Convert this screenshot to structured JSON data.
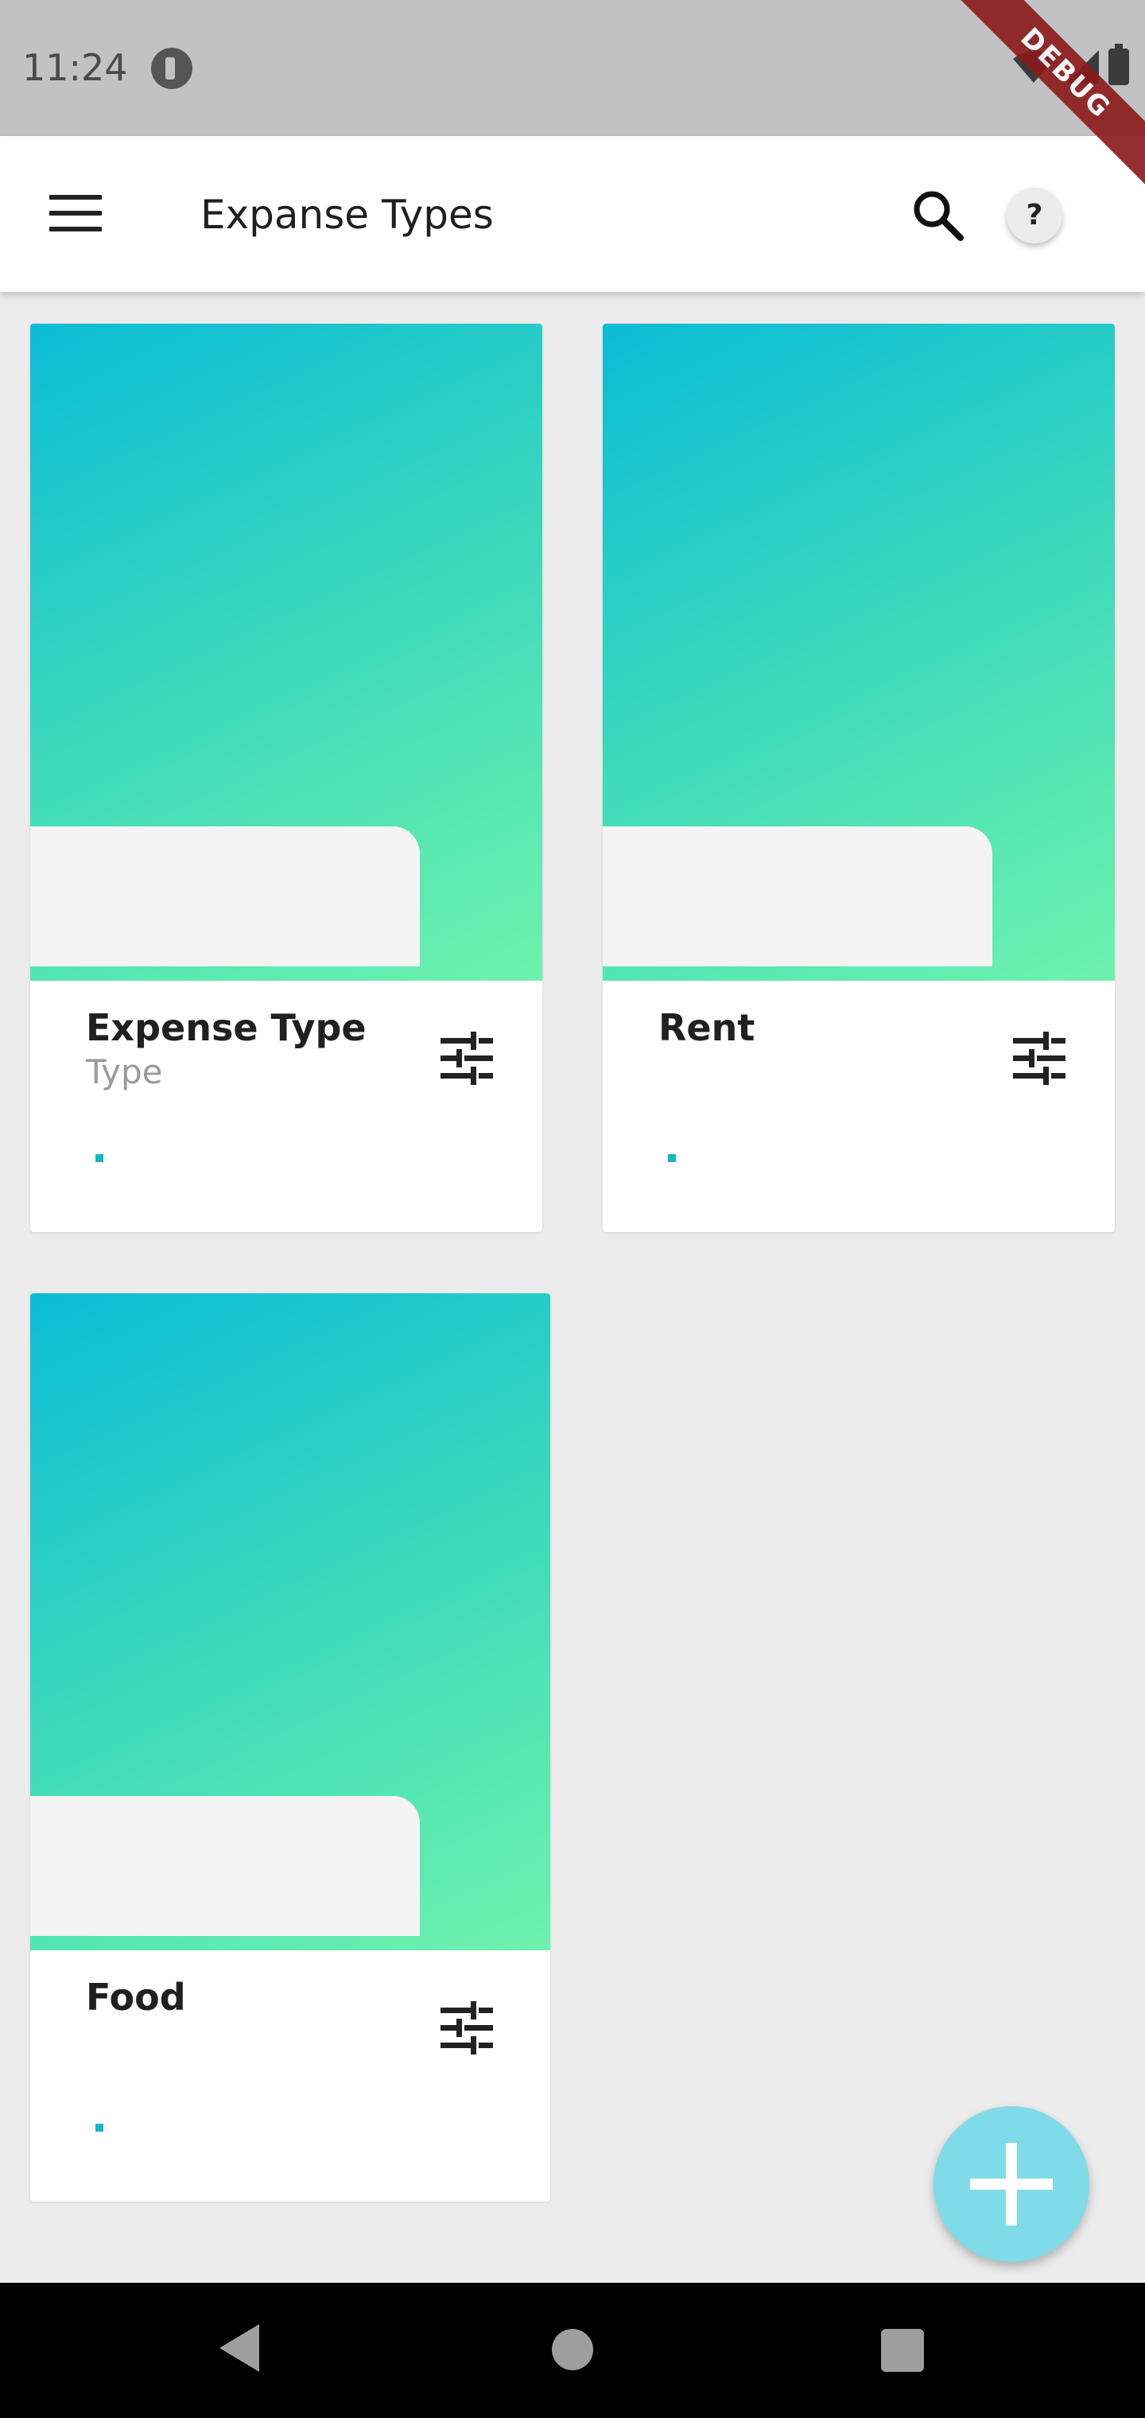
{
  "status_bar": {
    "time": "11:24",
    "icons": [
      "app-notification-icon",
      "wifi-icon",
      "signal-icon",
      "battery-icon"
    ]
  },
  "debug_banner": "DEBUG",
  "app_bar": {
    "title": "Expanse Types",
    "menu_icon": "menu-icon",
    "search_icon": "search-icon",
    "help_label": "?"
  },
  "cards": [
    {
      "title": "Expense Type",
      "subtitle": "Type",
      "action_icon": "tune-icon"
    },
    {
      "title": "Rent",
      "subtitle": "",
      "action_icon": "tune-icon"
    },
    {
      "title": "Food",
      "subtitle": "",
      "action_icon": "tune-icon"
    }
  ],
  "fab": {
    "icon": "plus-icon"
  },
  "nav_bar": {
    "icons": [
      "back-icon",
      "home-icon",
      "recents-icon"
    ]
  },
  "colors": {
    "gradient_start": "#0bbcd6",
    "gradient_end": "#6ef2ad",
    "fab": "#7fdbe8",
    "accent_dot": "#16b6c8"
  }
}
